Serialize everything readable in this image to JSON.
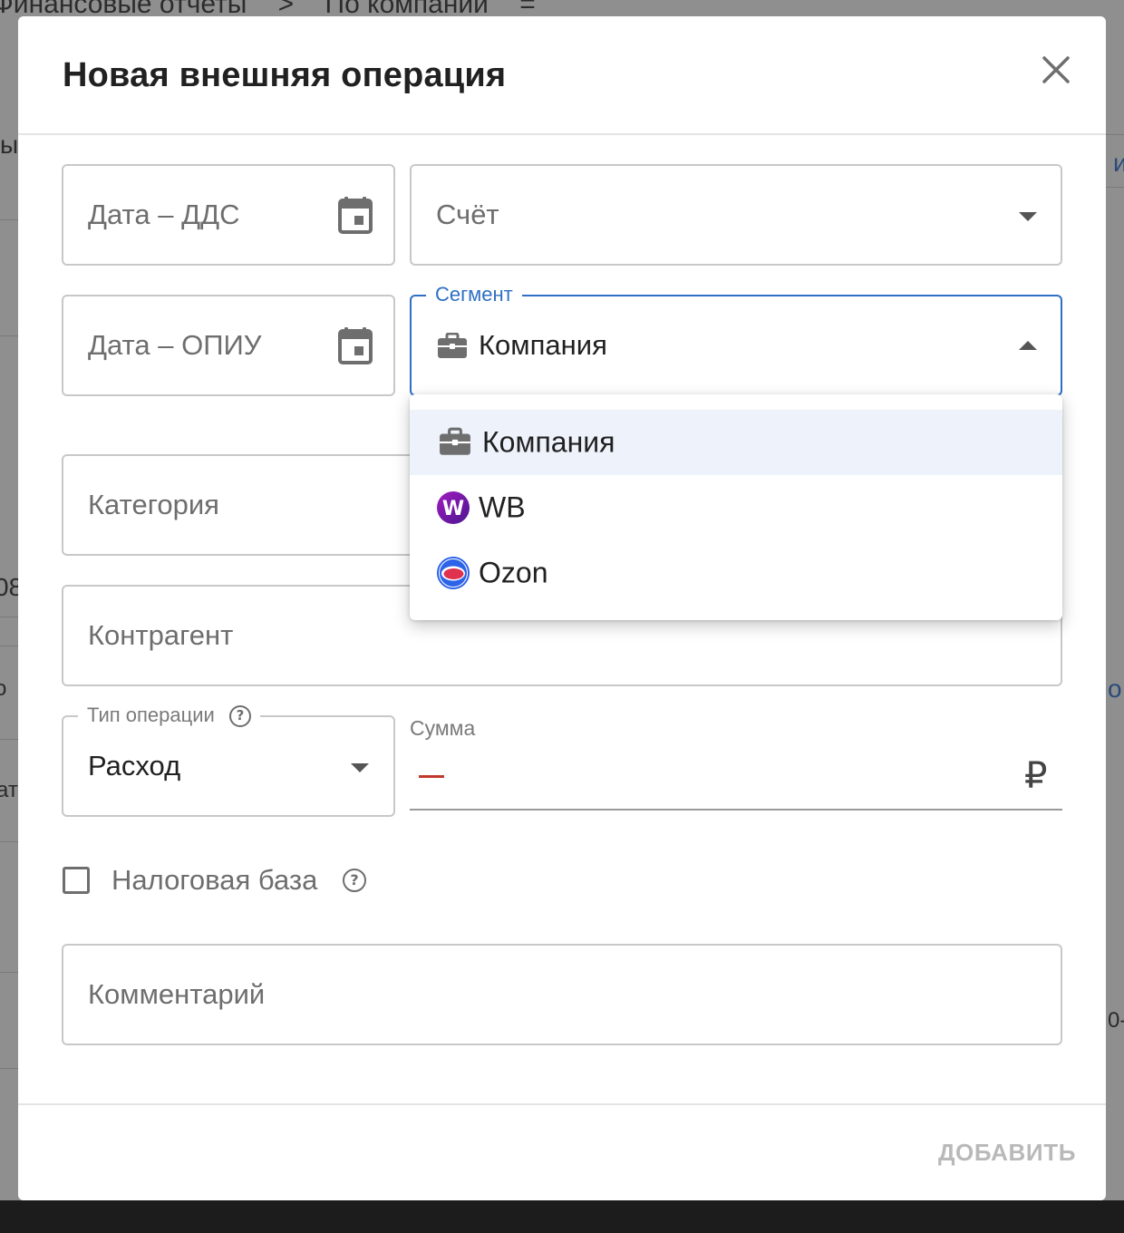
{
  "background": {
    "breadcrumb": [
      "Финансовые отчеты",
      ">",
      "По компании",
      "="
    ],
    "fragments": {
      "left_1": "ы",
      "left_2": "08",
      "left_3": "о",
      "left_4": "ат",
      "right_1": "и",
      "right_2": "о",
      "right_3": "0-"
    }
  },
  "modal": {
    "title": "Новая внешняя операция",
    "close_icon": "close-icon"
  },
  "fields": {
    "date_dds": {
      "placeholder": "Дата – ДДС",
      "icon": "calendar-icon"
    },
    "account": {
      "placeholder": "Счёт",
      "icon": "chevron-down-icon"
    },
    "date_opiu": {
      "placeholder": "Дата – ОПИУ",
      "icon": "calendar-icon"
    },
    "segment": {
      "label": "Сегмент",
      "value": "Компания",
      "icon": "briefcase-icon",
      "expanded": true
    },
    "category": {
      "placeholder": "Категория"
    },
    "counterparty": {
      "placeholder": "Контрагент"
    },
    "operation_type": {
      "label": "Тип операции",
      "value": "Расход",
      "help_icon": "help-icon"
    },
    "sum": {
      "label": "Сумма",
      "sign": "–",
      "value": "",
      "currency": "₽"
    },
    "tax_base": {
      "label": "Налоговая база",
      "checked": false,
      "help_icon": "help-icon"
    },
    "comment": {
      "placeholder": "Комментарий"
    }
  },
  "segment_menu": {
    "items": [
      {
        "label": "Компания",
        "icon": "briefcase-icon",
        "selected": true
      },
      {
        "label": "WB",
        "icon": "wildberries-logo-icon",
        "selected": false
      },
      {
        "label": "Ozon",
        "icon": "ozon-logo-icon",
        "selected": false
      }
    ]
  },
  "footer": {
    "add_label": "ДОБАВИТЬ"
  },
  "colors": {
    "accent": "#2f6fc4",
    "menu_selected_bg": "#edf2fb",
    "minus": "#c0392b",
    "disabled_text": "#b9b9b9"
  }
}
